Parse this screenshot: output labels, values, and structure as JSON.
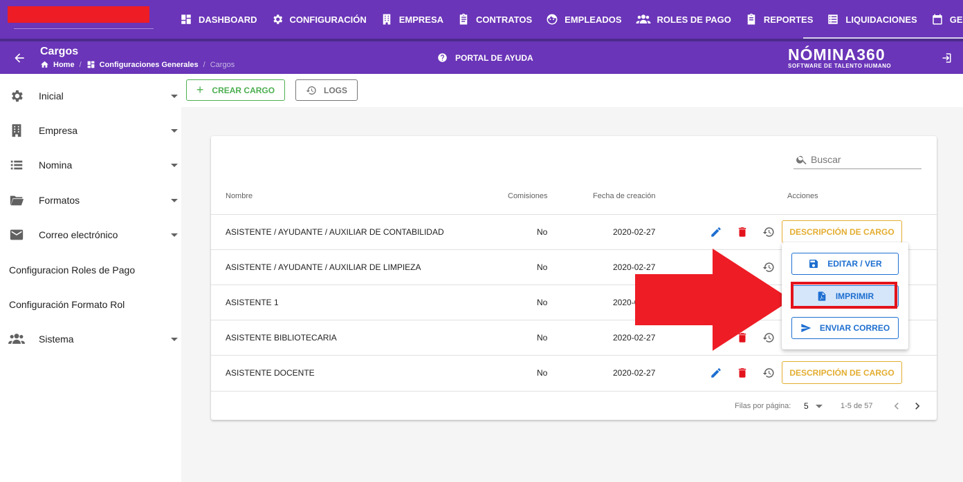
{
  "topnav": {
    "items": [
      {
        "label": "DASHBOARD",
        "icon": "dashboard-icon"
      },
      {
        "label": "CONFIGURACIÓN",
        "icon": "gear-icon"
      },
      {
        "label": "EMPRESA",
        "icon": "building-icon"
      },
      {
        "label": "CONTRATOS",
        "icon": "clipboard-icon"
      },
      {
        "label": "EMPLEADOS",
        "icon": "face-icon"
      },
      {
        "label": "ROLES DE PAGO",
        "icon": "people-icon"
      },
      {
        "label": "REPORTES",
        "icon": "report-icon"
      },
      {
        "label": "LIQUIDACIONES",
        "icon": "list-icon"
      },
      {
        "label": "GES",
        "icon": "calendar-icon"
      }
    ]
  },
  "header": {
    "title": "Cargos",
    "breadcrumb": [
      "Home",
      "Configuraciones Generales",
      "Cargos"
    ],
    "help_label": "PORTAL DE AYUDA",
    "brand_name": "NÓMINA360",
    "brand_tagline": "SOFTWARE DE TALENTO HUMANO"
  },
  "sidebar": {
    "items": [
      {
        "label": "Inicial",
        "icon": "gear-icon",
        "expandable": true
      },
      {
        "label": "Empresa",
        "icon": "building-icon",
        "expandable": true
      },
      {
        "label": "Nomina",
        "icon": "list-icon",
        "expandable": true
      },
      {
        "label": "Formatos",
        "icon": "folder-icon",
        "expandable": true
      },
      {
        "label": "Correo electrónico",
        "icon": "mail-icon",
        "expandable": true
      },
      {
        "label": "Configuracion Roles de Pago",
        "icon": "",
        "expandable": false
      },
      {
        "label": "Configuración Formato Rol",
        "icon": "",
        "expandable": false
      },
      {
        "label": "Sistema",
        "icon": "people-icon",
        "expandable": true
      }
    ]
  },
  "toolbar": {
    "create_label": "CREAR CARGO",
    "logs_label": "LOGS"
  },
  "table": {
    "search_placeholder": "Buscar",
    "headers": {
      "name": "Nombre",
      "commissions": "Comisiones",
      "created": "Fecha de creación",
      "actions": "Acciones"
    },
    "rows": [
      {
        "name": "ASISTENTE / AYUDANTE / AUXILIAR DE CONTABILIDAD",
        "commissions": "No",
        "created": "2020-02-27",
        "show_desc": true
      },
      {
        "name": "ASISTENTE / AYUDANTE / AUXILIAR DE LIMPIEZA",
        "commissions": "No",
        "created": "2020-02-27",
        "show_desc": false
      },
      {
        "name": "ASISTENTE 1",
        "commissions": "No",
        "created": "2020-0",
        "show_desc": false
      },
      {
        "name": "ASISTENTE BIBLIOTECARIA",
        "commissions": "No",
        "created": "2020-02-27",
        "show_desc": false
      },
      {
        "name": "ASISTENTE DOCENTE",
        "commissions": "No",
        "created": "2020-02-27",
        "show_desc": true
      }
    ],
    "desc_button_label": "DESCRIPCIÓN DE CARGO",
    "footer": {
      "rows_per_page_label": "Filas por página:",
      "rows_per_page": "5",
      "range": "1-5 de 57"
    }
  },
  "menu": {
    "edit_label": "EDITAR / VER",
    "print_label": "IMPRIMIR",
    "email_label": "ENVIAR CORREO"
  },
  "colors": {
    "primary": "#6a35b8",
    "create": "#4caf50",
    "desc": "#e3ad30",
    "menu": "#1e6fd0",
    "delete": "#e3131c",
    "annotation": "#ee1c25"
  }
}
